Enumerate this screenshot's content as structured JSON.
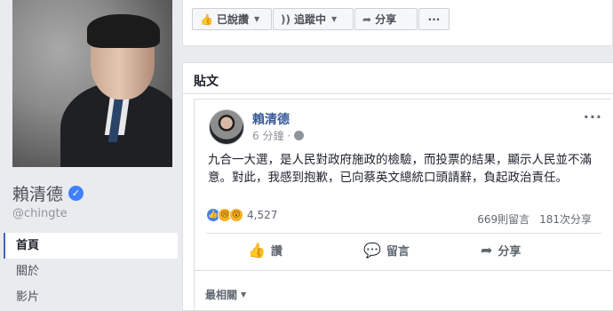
{
  "profile": {
    "name": "賴清德",
    "handle": "@chingte"
  },
  "nav": {
    "items": [
      {
        "label": "首頁"
      },
      {
        "label": "關於"
      },
      {
        "label": "影片"
      }
    ]
  },
  "actions": {
    "like_label": "已說讚",
    "follow_label": "追蹤中",
    "share_label": "分享",
    "more_label": "···"
  },
  "posts_section": {
    "title": "貼文"
  },
  "post": {
    "author": "賴清德",
    "time": "6 分鐘 ·",
    "text": "九合一大選，是人民對政府施政的檢驗，而投票的結果，顯示人民並不滿意。對此，我感到抱歉，已向蔡英文總統口頭請辭，負起政治責任。",
    "reaction_count": "4,527",
    "comments": "669則留言",
    "shares": "181次分享",
    "like_action": "讚",
    "comment_action": "留言",
    "share_action": "分享",
    "sort_label": "最相關"
  },
  "icons": {
    "verified": "verified-badge-icon",
    "like": "thumbs-up-icon",
    "follow": "rss-icon",
    "share": "share-arrow-icon",
    "globe": "globe-icon"
  },
  "colors": {
    "link": "#365899",
    "background": "#e9ebee",
    "like_blue": "#4080ff"
  }
}
